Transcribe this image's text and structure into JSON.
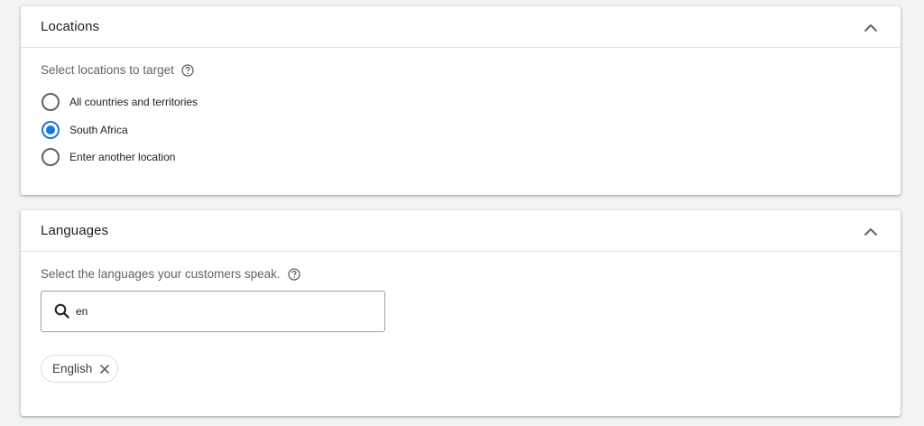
{
  "locations": {
    "title": "Locations",
    "prompt": "Select locations to target",
    "options": [
      {
        "label": "All countries and territories",
        "selected": false
      },
      {
        "label": "South Africa",
        "selected": true
      },
      {
        "label": "Enter another location",
        "selected": false
      }
    ]
  },
  "languages": {
    "title": "Languages",
    "prompt": "Select the languages your customers speak.",
    "search": {
      "value": "en"
    },
    "selected_chips": [
      {
        "label": "English"
      }
    ]
  },
  "colors": {
    "accent": "#1a73e8",
    "text": "#202124",
    "muted": "#5f6368"
  }
}
